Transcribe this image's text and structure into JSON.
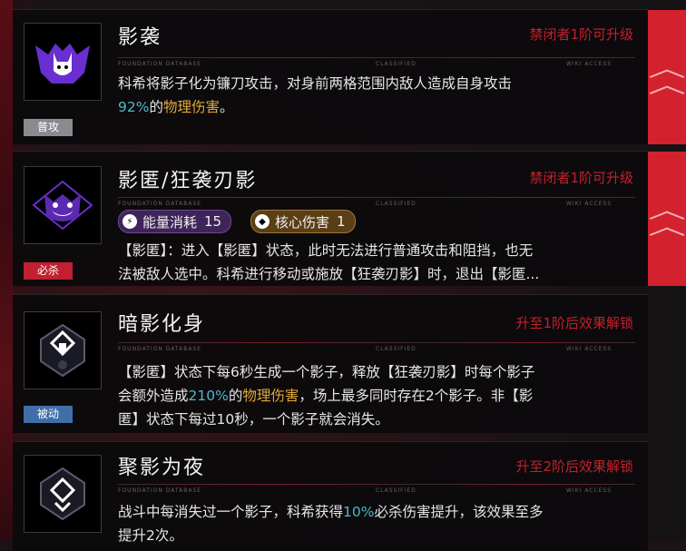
{
  "colors": {
    "accent_red": "#d4212e",
    "tag_gray": "#8a8a90",
    "tag_red": "#c02030",
    "tag_blue": "#3f6ea8",
    "highlight_blue": "#4fb8c9",
    "highlight_gold": "#e0a93a",
    "chip_energy": "#4a2a6a",
    "chip_core": "#6a4a1a"
  },
  "skills": [
    {
      "title": "影袭",
      "tag": "普攻",
      "upgrade": "禁闭者1阶可升级",
      "icon": "cat-mask-icon",
      "desc": {
        "p1": "科希将影子化为镰刀攻击，对身前两格范围内敌人造成自身攻击",
        "v1": "92%",
        "p2": "的",
        "v2": "物理伤害",
        "p3": "。"
      }
    },
    {
      "title": "影匿/狂袭刃影",
      "tag": "必杀",
      "upgrade": "禁闭者1阶可升级",
      "icon": "grinning-cat-icon",
      "chips": [
        {
          "label": "能量消耗",
          "value": "15",
          "icon": "lightning-icon"
        },
        {
          "label": "核心伤害",
          "value": "1",
          "icon": "diamond-icon"
        }
      ],
      "desc": {
        "line1": "【影匿】：进入【影匿】状态，此时无法进行普通攻击和阻挡，也无",
        "line2": "法被敌人选中。科希进行移动或施放【狂袭刃影】时，退出【影匿..."
      }
    },
    {
      "title": "暗影化身",
      "tag": "被动",
      "upgrade": "升至1阶后效果解锁",
      "icon": "shadow-emblem-icon",
      "desc": {
        "p1": "【影匿】状态下每6秒生成一个影子，释放【狂袭刃影】时每个影子",
        "p2": "会额外造成",
        "v1": "210%",
        "p3": "的",
        "v2": "物理伤害",
        "p4": "，场上最多同时存在2个影子。非【影",
        "p5": "匿】状态下每过10秒，一个影子就会消失。"
      }
    },
    {
      "title": "聚影为夜",
      "upgrade": "升至2阶后效果解锁",
      "icon": "night-emblem-icon",
      "desc": {
        "p1": "战斗中每消失过一个影子，科希获得",
        "v1": "10%",
        "p2": "必杀伤害提升，该效果至多",
        "p3": "提升2次。"
      }
    }
  ],
  "mini_text": {
    "left": "FOUNDATION DATABASE",
    "mid": "CLASSIFIED",
    "right": "WIKI ACCESS"
  }
}
